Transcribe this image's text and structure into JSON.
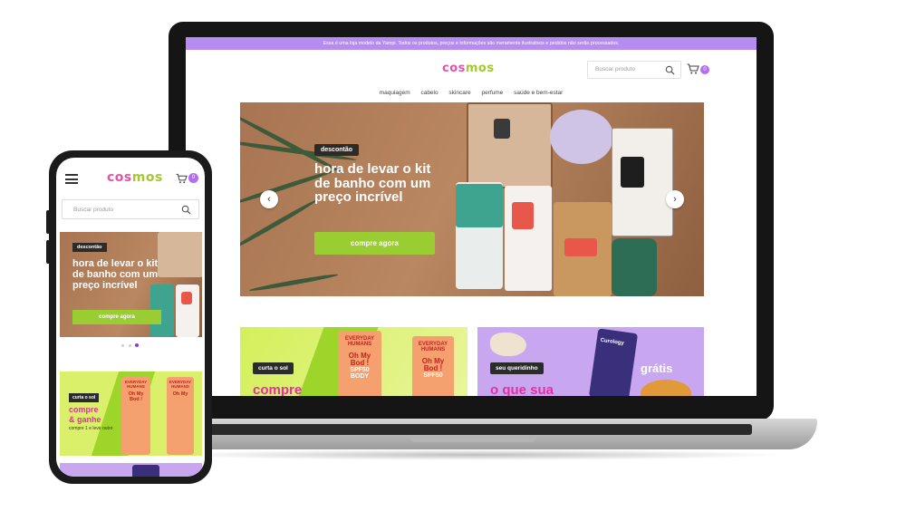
{
  "laptop": {
    "announcement": "Essa é uma loja modelo da Yampi. Todos os produtos, preços e informações são meramente ilustrativos e pedidos não serão processados.",
    "logo": {
      "part1": "cos",
      "part2": "mos"
    },
    "search": {
      "placeholder": "Buscar produto",
      "icon": "search-icon"
    },
    "cart": {
      "icon": "cart-icon",
      "count": "0"
    },
    "nav": [
      "maquiagem",
      "cabelo",
      "skincare",
      "perfume",
      "saúde e bem-estar"
    ],
    "hero": {
      "tag": "descontão",
      "title": "hora de levar o kit de banho com um preço incrível",
      "button": "compre agora",
      "prev_icon": "chevron-left-icon",
      "next_icon": "chevron-right-icon"
    },
    "promo_left": {
      "tag": "curta o sol",
      "headline": "compre",
      "product_line1": "EVERYDAY",
      "product_line2": "HUMANS",
      "product_line3": "Oh My",
      "product_line4": "Bod !",
      "product_line5": "SPF50",
      "product_line6": "BODY"
    },
    "promo_right": {
      "tag": "seu queridinho",
      "headline": "o que sua",
      "badge": "grátis",
      "brand": "Curology"
    }
  },
  "phone": {
    "logo": {
      "part1": "cos",
      "part2": "mos"
    },
    "menu_icon": "hamburger-icon",
    "search": {
      "placeholder": "Buscar produto"
    },
    "cart": {
      "count": "0"
    },
    "hero": {
      "tag": "descontão",
      "title": "hora de levar o kit de banho com um preço incrível",
      "button": "compre agora"
    },
    "carousel": {
      "pages": 3,
      "active": 3
    },
    "promo": {
      "tag": "curta o sol",
      "headline_line1": "compre",
      "headline_line2": "& ganhe",
      "subtext": "compre 1 e leve outro"
    }
  },
  "colors": {
    "announcement_bg": "#b78cf0",
    "logo_pink": "#e552a8",
    "logo_green": "#a3c92e",
    "cta_green": "#9acd32",
    "promo_pink": "#e42fa0",
    "promo_yellow": "#dbf06a",
    "promo_lavender": "#c9a7f0"
  }
}
